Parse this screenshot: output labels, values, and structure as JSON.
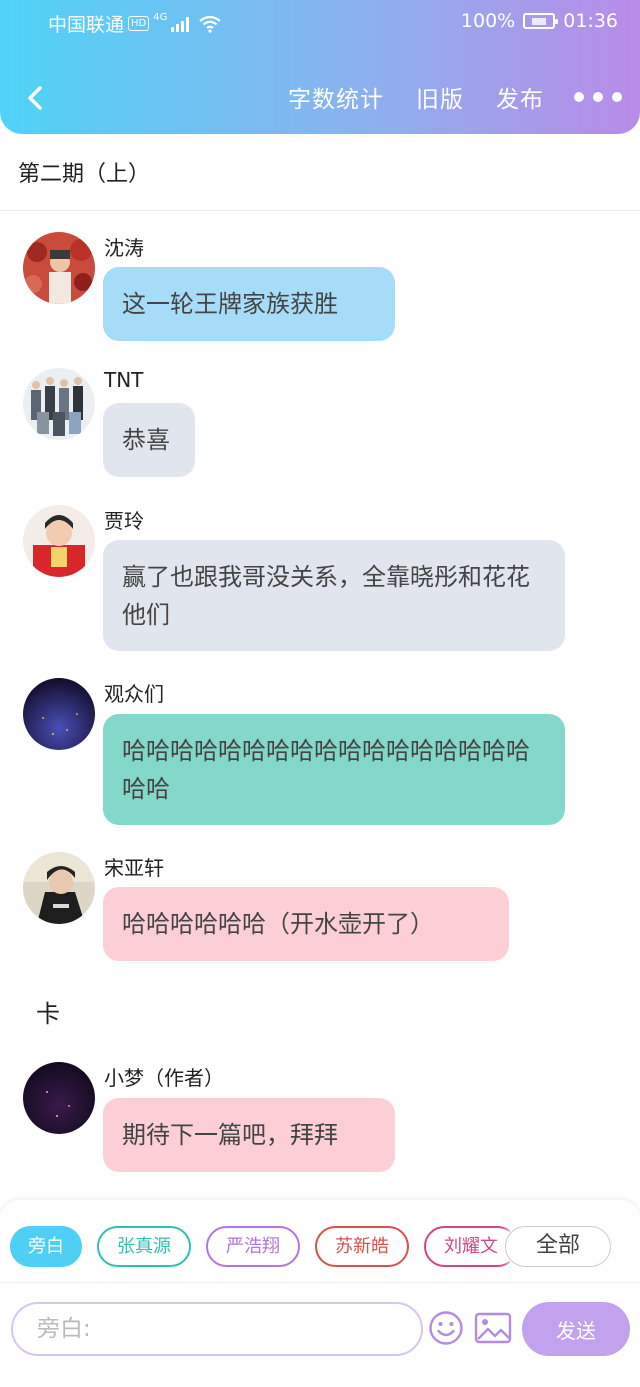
{
  "status_bar": {
    "carrier": "中国联通",
    "hd": "HD",
    "network": "4G",
    "battery": "100%",
    "time": "01:36"
  },
  "nav": {
    "word_count": "字数统计",
    "old_version": "旧版",
    "publish": "发布"
  },
  "chapter_title": "第二期（上）",
  "messages": [
    {
      "sender": "沈涛",
      "text": "这一轮王牌家族获胜"
    },
    {
      "sender": "TNT",
      "text": "恭喜"
    },
    {
      "sender": "贾玲",
      "text": "赢了也跟我哥没关系，全靠晓彤和花花他们"
    },
    {
      "sender": "观众们",
      "text": "哈哈哈哈哈哈哈哈哈哈哈哈哈哈哈哈哈哈哈"
    },
    {
      "sender": "宋亚轩",
      "text": "哈哈哈哈哈哈（开水壶开了）"
    },
    {
      "sender": "小梦（作者）",
      "text": "期待下一篇吧，拜拜"
    }
  ],
  "narration": "卡",
  "role_chips": [
    "旁白",
    "张真源",
    "严浩翔",
    "苏新皓",
    "刘耀文"
  ],
  "all_chip": "全部",
  "input": {
    "placeholder": "旁白:"
  },
  "send_label": "发送",
  "colors": {
    "header_gradient": [
      "#4fd3f6",
      "#b98be8"
    ],
    "bubble_blue": "#a7dcf8",
    "bubble_gray": "#e0e5ee",
    "bubble_teal": "#84d8ca",
    "bubble_pink": "#fccfd7",
    "send_button": "#c2a2ec"
  }
}
